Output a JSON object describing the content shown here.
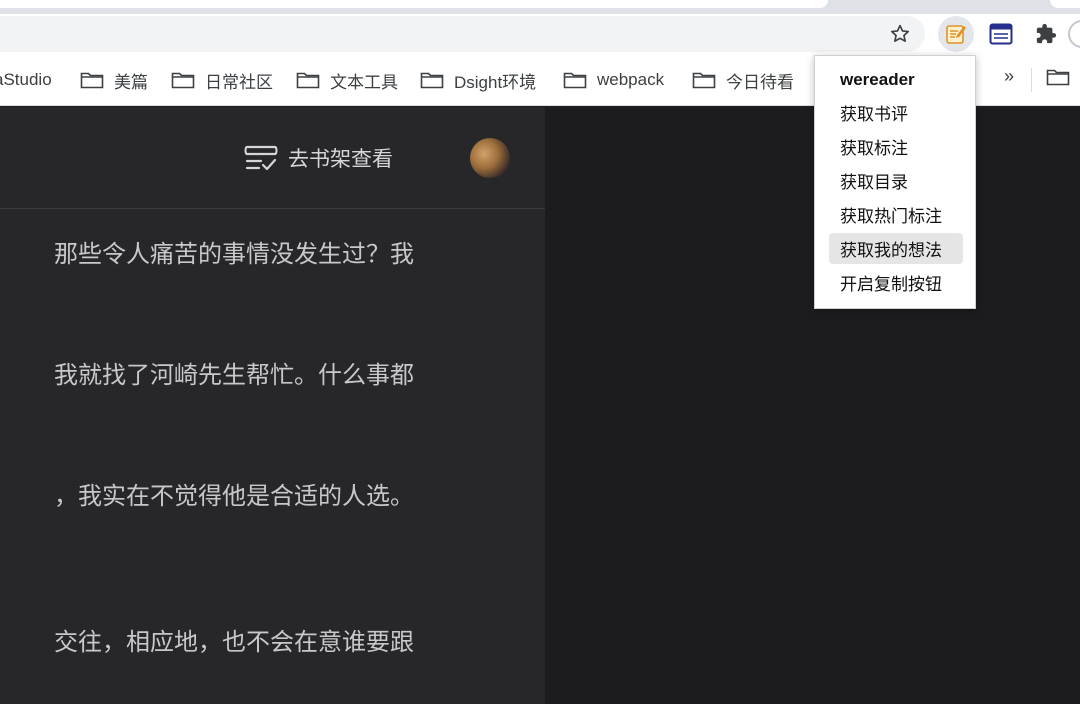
{
  "browser": {
    "bookmarks": [
      {
        "label": "aStudio"
      },
      {
        "label": "美篇"
      },
      {
        "label": "日常社区"
      },
      {
        "label": "文本工具"
      },
      {
        "label": "Dsight环境"
      },
      {
        "label": "webpack"
      },
      {
        "label": "今日待看"
      }
    ],
    "more_label": "»"
  },
  "popup": {
    "title": "wereader",
    "items": [
      {
        "label": "获取书评"
      },
      {
        "label": "获取标注"
      },
      {
        "label": "获取目录"
      },
      {
        "label": "获取热门标注"
      },
      {
        "label": "获取我的想法",
        "hovered": true
      },
      {
        "label": "开启复制按钮"
      }
    ]
  },
  "reader": {
    "shelf_label": "去书架查看",
    "paragraphs": [
      "那些令人痛苦的事情没发生过？我",
      "我就找了河崎先生帮忙。什么事都",
      "，我实在不觉得他是合适的人选。",
      "交往，相应地，也不会在意谁要跟"
    ]
  },
  "colors": {
    "reader_bg": "#27272a",
    "page_bg": "#1c1c1e",
    "text": "#c8c8cc",
    "menu_hover": "#e5e5e5"
  },
  "icons": [
    "star-icon",
    "wereader-extension-icon",
    "reader-mode-icon",
    "puzzle-extensions-icon",
    "folder-icon",
    "bookshelf-icon"
  ]
}
